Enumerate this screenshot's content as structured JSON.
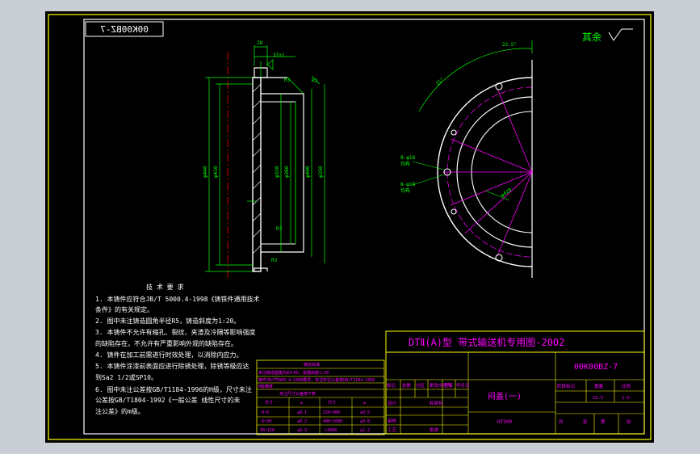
{
  "drawing_number_mirrored": "00K00BZ-7",
  "surface_note": "其余",
  "surface_symbol": "Ra",
  "dims": {
    "d1": "28",
    "d2": "37±1",
    "d3": "R3",
    "d4": "R3",
    "d5": "φ440",
    "d6": "φ410",
    "d7": "φ320",
    "d8": "φ360",
    "d9": "φ400",
    "d10": "R3",
    "d11": "φ350",
    "angle_label": "15°",
    "a1": "22.5°"
  },
  "leaders": {
    "l1": "8-φ18",
    "l2": "均布",
    "l3": "8-φ18",
    "l4": "均布",
    "pcd": "φ420"
  },
  "tech_req": {
    "title": "技  术  要  求",
    "lines": [
      "1. 本铸件应符合JB/T 5000.4-1998《铸铁件通用技术",
      "   条件》的有关规定。",
      "2. 图中未注铸造圆角半径R5，铸造斜度为1:20。",
      "3. 本铸件不允许有缩孔、裂纹、夹渣及冷隔等影响强度",
      "   的缺陷存在，不允许有严重影响外观的缺陷存在。",
      "4. 铸件在加工前需进行时效处理，以消除内应力。",
      "5. 本铸件涂漆前表面应进行除锈处理，除锈等级应达",
      "   到Sa2 1/2或SP10。",
      "6. 图中未注公差按GB/T1184-1996的H级，尺寸未注",
      "   公差按GB/T1804-1992《一般公差 线性尺寸的未",
      "   注公差》的m级。"
    ]
  },
  "small_table": {
    "title": "铸造标准",
    "rows": [
      "未注铸造圆角为R3~R5，拔模斜度1:20",
      "铸件JB/T5000.4-1998要求，未注形位公差按GB/T1184-1996",
      "H级精度",
      "未注尺寸公差按下表"
    ],
    "grid": [
      [
        "尺寸",
        "±",
        "尺寸",
        "±"
      ],
      [
        "0~6",
        "±0.1",
        "120~400",
        "±0.5"
      ],
      [
        "6~30",
        "±0.2",
        "400~1000",
        "±0.8"
      ],
      [
        "30~120",
        "±0.3",
        ">1000",
        "±1.2"
      ]
    ]
  },
  "title_block": {
    "series": "DTⅡ(A)型  带式输送机专用图-2002",
    "drawing_no": "00K00BZ-7",
    "part_name": "闷盖(一)",
    "material": "HT200",
    "weight": "22.5",
    "scale": "1:5",
    "h_stage": "阶段标记",
    "h_weight": "重量",
    "h_scale": "比例",
    "h_sheet": "共",
    "h_sheet2": "张",
    "h_sheet3": "第",
    "h_sheet4": "张",
    "rev_mark": "标记",
    "rev_count": "处数",
    "rev_zone": "分区",
    "rev_doc": "更改文件号",
    "rev_sign": "签名",
    "rev_date": "年月日",
    "designer": "设计",
    "std": "标准化",
    "checker": "审核",
    "process": "工艺",
    "approve": "批准"
  }
}
